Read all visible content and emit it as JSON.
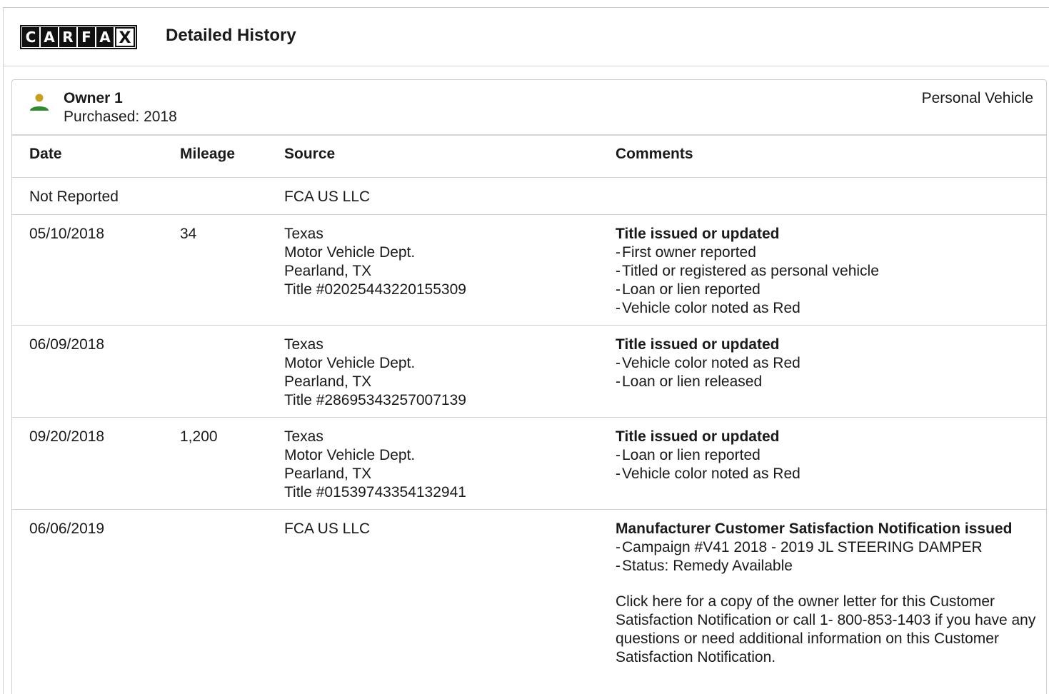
{
  "header": {
    "logo_letters": [
      "C",
      "A",
      "R",
      "F",
      "A",
      "X"
    ],
    "title": "Detailed History"
  },
  "owner": {
    "name": "Owner 1",
    "purchased": "Purchased: 2018",
    "type": "Personal Vehicle",
    "icon": "person-icon",
    "icon_colors": {
      "head": "#c8a020",
      "body": "#2e8b2e"
    }
  },
  "table": {
    "headers": {
      "date": "Date",
      "mileage": "Mileage",
      "source": "Source",
      "comments": "Comments"
    },
    "rows": [
      {
        "date": "Not Reported",
        "mileage": "",
        "source": [
          "FCA US LLC"
        ],
        "comments": {
          "title": "",
          "bullets": [],
          "note": ""
        }
      },
      {
        "date": "05/10/2018",
        "mileage": "34",
        "source": [
          "Texas",
          "Motor Vehicle Dept.",
          "Pearland, TX",
          "Title #02025443220155309"
        ],
        "comments": {
          "title": "Title issued or updated",
          "bullets": [
            "First owner reported",
            "Titled or registered as personal vehicle",
            "Loan or lien reported",
            "Vehicle color noted as Red"
          ],
          "note": ""
        }
      },
      {
        "date": "06/09/2018",
        "mileage": "",
        "source": [
          "Texas",
          "Motor Vehicle Dept.",
          "Pearland, TX",
          "Title #28695343257007139"
        ],
        "comments": {
          "title": "Title issued or updated",
          "bullets": [
            "Vehicle color noted as Red",
            "Loan or lien released"
          ],
          "note": ""
        }
      },
      {
        "date": "09/20/2018",
        "mileage": "1,200",
        "source": [
          "Texas",
          "Motor Vehicle Dept.",
          "Pearland, TX",
          "Title #01539743354132941"
        ],
        "comments": {
          "title": "Title issued or updated",
          "bullets": [
            "Loan or lien reported",
            "Vehicle color noted as Red"
          ],
          "note": ""
        }
      },
      {
        "date": "06/06/2019",
        "mileage": "",
        "source": [
          "FCA US LLC"
        ],
        "comments": {
          "title": "Manufacturer Customer Satisfaction Notification issued",
          "bullets": [
            "Campaign #V41 2018 - 2019 JL STEERING DAMPER",
            "Status: Remedy Available"
          ],
          "note": "Click here for a copy of the owner letter for this Customer Satisfaction Notification or call 1- 800-853-1403 if you have any questions or need additional information on this Customer Satisfaction Notification."
        }
      }
    ]
  }
}
